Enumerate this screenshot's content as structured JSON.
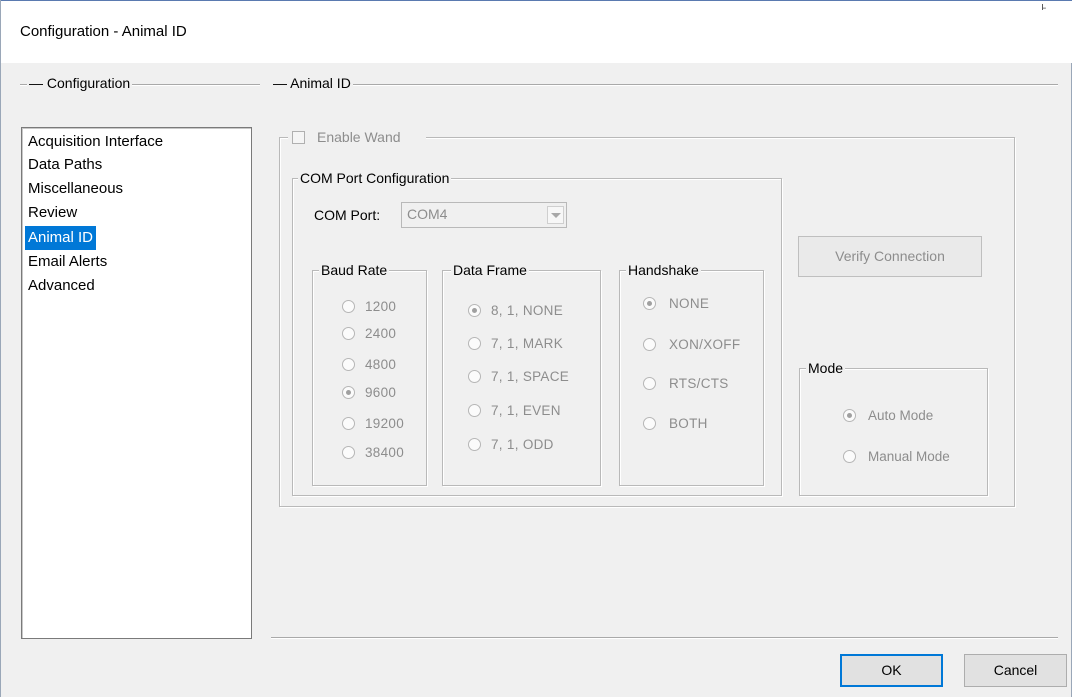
{
  "window": {
    "title": "Configuration - Animal ID",
    "corner_mark": "ı̵"
  },
  "sidebar": {
    "group_label": "Configuration",
    "items": [
      {
        "label": "Acquisition Interface",
        "selected": false
      },
      {
        "label": "Data Paths",
        "selected": false
      },
      {
        "label": "Miscellaneous",
        "selected": false
      },
      {
        "label": "Review",
        "selected": false
      },
      {
        "label": "Animal ID",
        "selected": true
      },
      {
        "label": "Email Alerts",
        "selected": false
      },
      {
        "label": "Advanced",
        "selected": false
      }
    ]
  },
  "panel": {
    "group_label": "Animal ID",
    "enable_wand": {
      "label": "Enable Wand",
      "checked": false
    },
    "com_config": {
      "label": "COM Port Configuration",
      "port_label": "COM Port:",
      "port_value": "COM4"
    },
    "baud_rate": {
      "label": "Baud Rate",
      "options": [
        "1200",
        "2400",
        "4800",
        "9600",
        "19200",
        "38400"
      ],
      "selected": "9600"
    },
    "data_frame": {
      "label": "Data Frame",
      "options": [
        "8, 1, NONE",
        "7, 1, MARK",
        "7, 1, SPACE",
        "7, 1, EVEN",
        "7, 1, ODD"
      ],
      "selected": "8, 1, NONE"
    },
    "handshake": {
      "label": "Handshake",
      "options": [
        "NONE",
        "XON/XOFF",
        "RTS/CTS",
        "BOTH"
      ],
      "selected": "NONE"
    },
    "verify_button": "Verify Connection",
    "mode": {
      "label": "Mode",
      "options": [
        "Auto Mode",
        "Manual Mode"
      ],
      "selected": "Auto Mode"
    }
  },
  "footer": {
    "ok": "OK",
    "cancel": "Cancel"
  },
  "colors": {
    "selection": "#0078d7",
    "disabled_text": "#8d8d8d",
    "window_bg": "#f0f0f0"
  }
}
